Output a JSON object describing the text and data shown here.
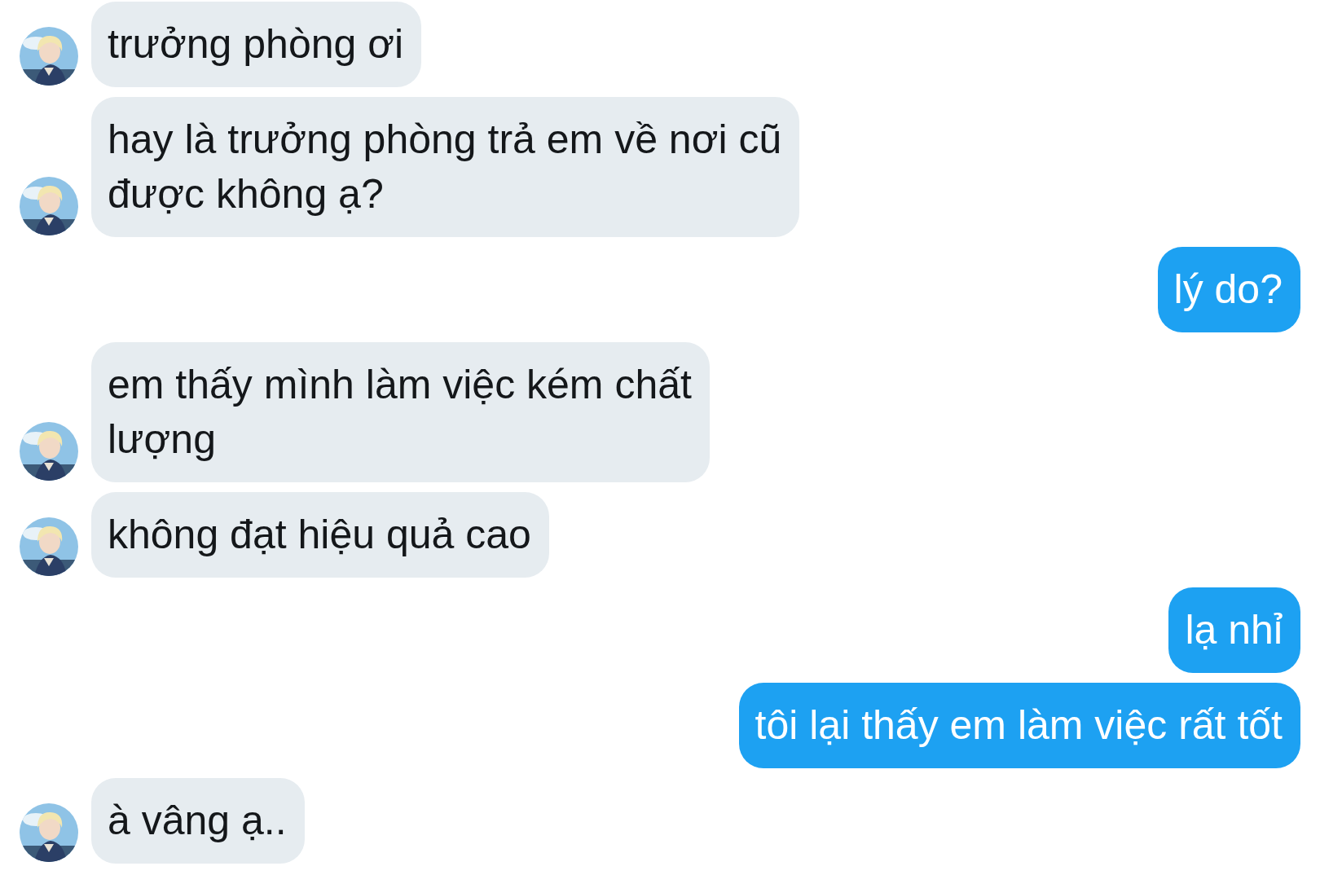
{
  "messages": [
    {
      "kind": "incoming",
      "text": "trưởng phòng ơi"
    },
    {
      "kind": "incoming",
      "text": "hay là trưởng phòng trả em về nơi cũ\nđược không ạ?"
    },
    {
      "kind": "outgoing",
      "text": "lý do?"
    },
    {
      "kind": "incoming",
      "text": "em thấy mình làm việc kém chất\nlượng"
    },
    {
      "kind": "incoming",
      "text": "không đạt hiệu quả cao"
    },
    {
      "kind": "outgoing",
      "text": "lạ nhỉ"
    },
    {
      "kind": "outgoing",
      "text": "tôi lại thấy em làm việc rất tốt"
    },
    {
      "kind": "incoming",
      "text": "à vâng ạ.."
    }
  ]
}
